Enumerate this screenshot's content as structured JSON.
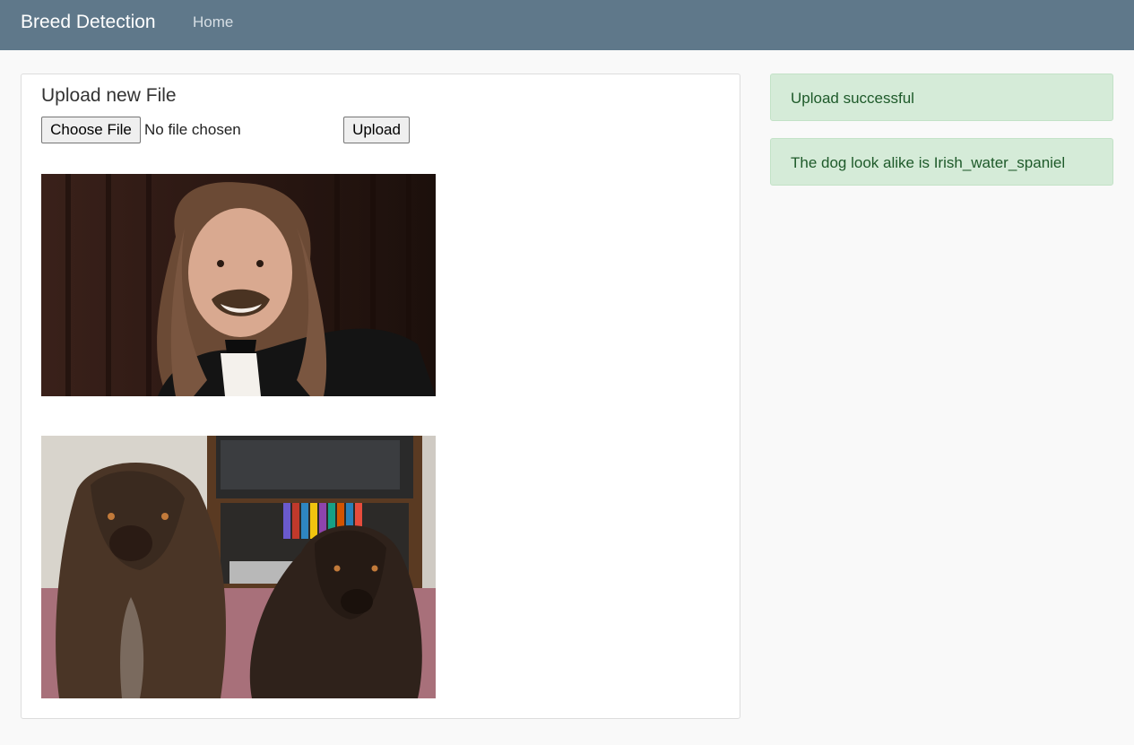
{
  "navbar": {
    "brand": "Breed Detection",
    "links": [
      {
        "label": "Home"
      }
    ]
  },
  "upload": {
    "title": "Upload new File",
    "choose_label": "Choose File",
    "file_status": "No file chosen",
    "submit_label": "Upload"
  },
  "images": [
    {
      "description": "uploaded person photo"
    },
    {
      "description": "matched dog breed photo"
    }
  ],
  "alerts": [
    {
      "text": "Upload successful"
    },
    {
      "text": "The dog look alike is Irish_water_spaniel"
    }
  ],
  "colors": {
    "navbar": "#5f788a",
    "alert_background": "#d5ebd8",
    "alert_text": "#1e5a2a",
    "page_background": "#f9f9f9"
  }
}
